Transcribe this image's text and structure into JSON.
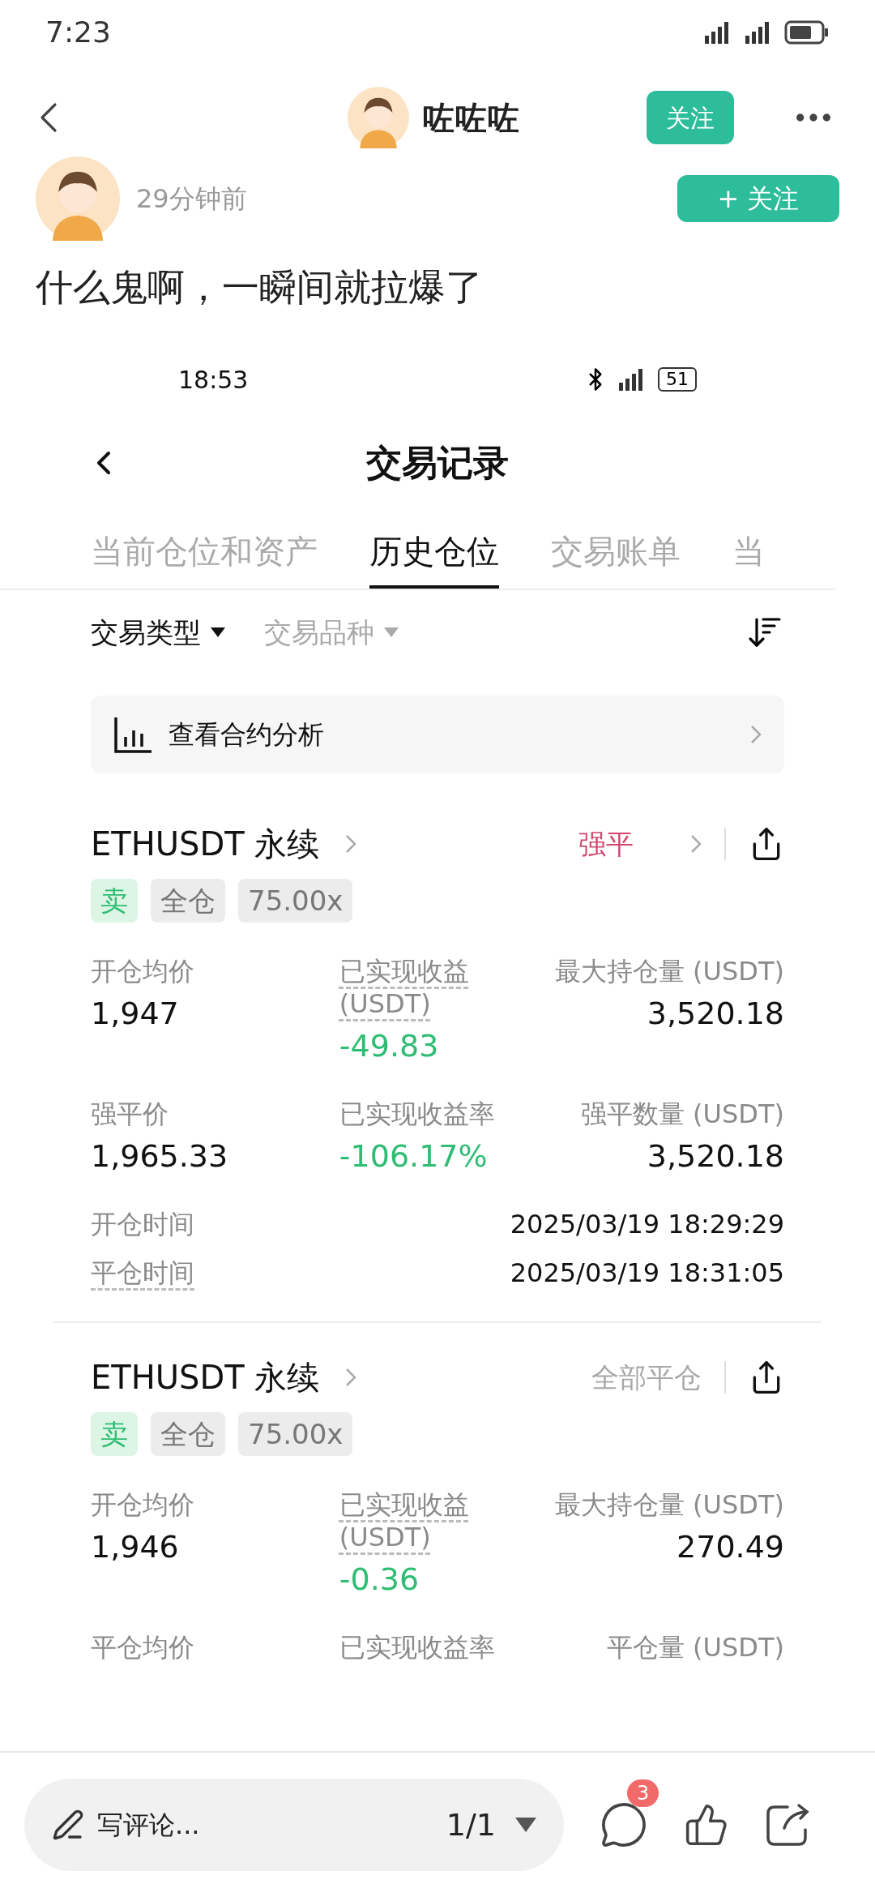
{
  "status_bar": {
    "time": "7:23"
  },
  "nav": {
    "author": "咗咗咗",
    "follow": "关注"
  },
  "post": {
    "time": "29分钟前",
    "follow": "+ 关注",
    "text": "什么鬼啊，一瞬间就拉爆了"
  },
  "screenshot": {
    "status_bar": {
      "time": "18:53",
      "battery": "51"
    },
    "title": "交易记录",
    "tabs": [
      {
        "label": "当前仓位和资产",
        "selected": false
      },
      {
        "label": "历史仓位",
        "selected": true
      },
      {
        "label": "交易账单",
        "selected": false
      },
      {
        "label": "当",
        "selected": false
      }
    ],
    "filters": [
      {
        "label": "交易类型",
        "active": true
      },
      {
        "label": "交易品种",
        "active": false
      }
    ],
    "analysis": "查看合约分析",
    "positions": [
      {
        "symbol": "ETHUSDT 永续",
        "status": {
          "label": "强平",
          "kind": "liquidation"
        },
        "tags": [
          {
            "label": "卖",
            "kind": "side"
          },
          {
            "label": "全仓",
            "kind": "plain"
          },
          {
            "label": "75.00x",
            "kind": "plain"
          }
        ],
        "stats": [
          [
            {
              "label": "开仓均价",
              "value": "1,947",
              "underlined": false
            },
            {
              "label": "已实现收益 (USDT)",
              "value": "-49.83",
              "underlined": true,
              "color": "#2ebd73"
            },
            {
              "label": "最大持仓量 (USDT)",
              "value": "3,520.18",
              "underlined": false
            }
          ],
          [
            {
              "label": "强平价",
              "value": "1,965.33",
              "underlined": false
            },
            {
              "label": "已实现收益率",
              "value": "-106.17%",
              "underlined": false,
              "color": "#2ebd73"
            },
            {
              "label": "强平数量 (USDT)",
              "value": "3,520.18",
              "underlined": false
            }
          ]
        ],
        "times": [
          {
            "label": "开仓时间",
            "value": "2025/03/19 18:29:29",
            "underlined": false
          },
          {
            "label": "平仓时间",
            "value": "2025/03/19 18:31:05",
            "underlined": true
          }
        ]
      },
      {
        "symbol": "ETHUSDT 永续",
        "status": {
          "label": "全部平仓",
          "kind": "closed"
        },
        "tags": [
          {
            "label": "卖",
            "kind": "side"
          },
          {
            "label": "全仓",
            "kind": "plain"
          },
          {
            "label": "75.00x",
            "kind": "plain"
          }
        ],
        "stats": [
          [
            {
              "label": "开仓均价",
              "value": "1,946",
              "underlined": false
            },
            {
              "label": "已实现收益 (USDT)",
              "value": "-0.36",
              "underlined": true,
              "color": "#2ebd73"
            },
            {
              "label": "最大持仓量 (USDT)",
              "value": "270.49",
              "underlined": false
            }
          ],
          [
            {
              "label": "平仓均价",
              "underlined": false
            },
            {
              "label": "已实现收益率",
              "underlined": false
            },
            {
              "label": "平仓量 (USDT)",
              "underlined": false
            }
          ]
        ]
      }
    ]
  },
  "comment_bar": {
    "placeholder": "写评论...",
    "page": "1/1",
    "comment_count": "3"
  }
}
